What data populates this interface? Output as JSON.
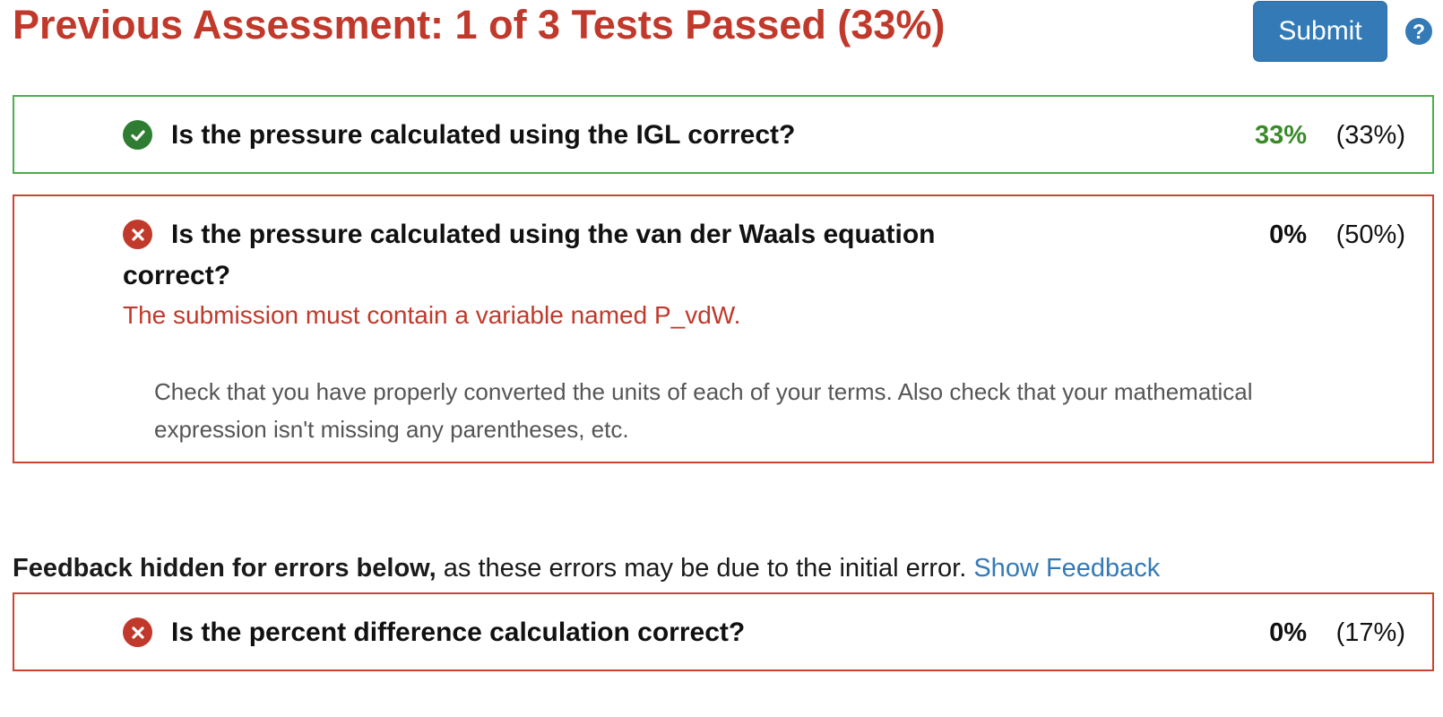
{
  "header": {
    "title": "Previous Assessment: 1 of 3 Tests Passed (33%)",
    "submit_label": "Submit",
    "help_icon": "question-circle-icon"
  },
  "tests": [
    {
      "status": "pass",
      "icon": "check-circle-icon",
      "question": "Is the pressure calculated using the IGL correct?",
      "score": "33%",
      "weight": "(33%)"
    },
    {
      "status": "fail",
      "icon": "x-circle-icon",
      "question": "Is the pressure calculated using the van der Waals equation correct?",
      "score": "0%",
      "weight": "(50%)",
      "error": "The submission must contain a variable named P_vdW.",
      "feedback": "Check that you have properly converted the units of each of your terms. Also check that your mathematical expression isn't missing any parentheses, etc."
    },
    {
      "status": "fail",
      "icon": "x-circle-icon",
      "question": "Is the percent difference calculation correct?",
      "score": "0%",
      "weight": "(17%)"
    }
  ],
  "hidden_feedback": {
    "bold_text": "Feedback hidden for errors below,",
    "text": " as these errors may be due to the initial error. ",
    "link_label": "Show Feedback"
  },
  "colors": {
    "error_red": "#c0392b",
    "pass_green": "#2e7d32",
    "primary_blue": "#337ab7"
  }
}
